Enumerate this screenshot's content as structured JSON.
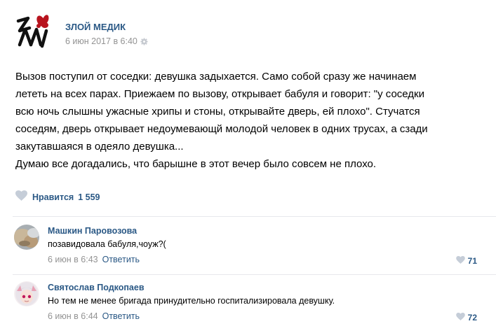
{
  "post": {
    "author": "ЗЛОЙ МЕДИК",
    "date": "6 июн 2017 в 6:40",
    "text": "Вызов поступил от соседки: девушка задыхается. Само собой сразу же начинаем\nлететь на всех парах. Приежаем по вызову, открывает бабуля и говорит: \"у соседки\nвсю ночь слышны ужасные хрипы и стоны, открывайте дверь, ей плохо\". Стучатся\nсоседям, дверь открывает недоумевающй молодой человек в одних трусах, а сзади\nзакутавшаяся в одеяло девушка...\nДумаю все догадались, что барышне в этот вечер было совсем не плохо.",
    "likes_label": "Нравится",
    "likes_count": "1 559"
  },
  "comments": [
    {
      "author": "Машкин Паровозова",
      "text": "позавидовала бабуля,чоуж?(",
      "date": "6 июн в 6:43",
      "reply_label": "Ответить",
      "likes": "71"
    },
    {
      "author": "Святослав Подкопаев",
      "text": "Но тем не менее бригада принудительно госпитализировала девушку.",
      "date": "6 июн в 6:44",
      "reply_label": "Ответить",
      "likes": "72"
    }
  ],
  "colors": {
    "link": "#2a5885",
    "meta": "#939393",
    "divider": "#e7e8ec",
    "logo_red": "#b8141e"
  },
  "icons": [
    "community-logo",
    "gear-icon",
    "heart-icon",
    "avatar-photo"
  ]
}
